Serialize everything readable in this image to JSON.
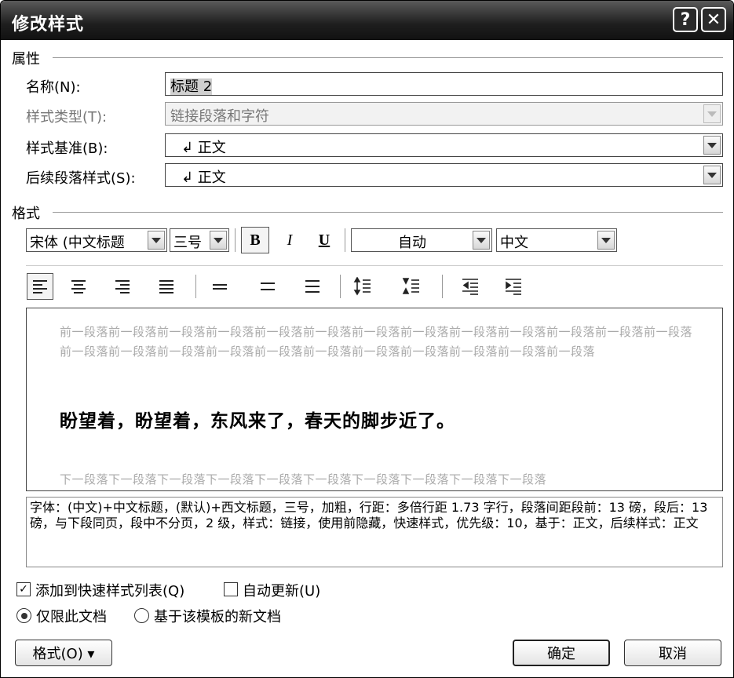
{
  "dialog": {
    "title": "修改样式",
    "help_label": "?",
    "close_label": "✕"
  },
  "properties": {
    "section_label": "属性",
    "name_label": "名称(N):",
    "name_value": "标题 2",
    "style_type_label": "样式类型(T):",
    "style_type_value": "链接段落和字符",
    "based_on_label": "样式基准(B):",
    "based_on_value": "↲ 正文",
    "following_label": "后续段落样式(S):",
    "following_value": "↲ 正文"
  },
  "format": {
    "section_label": "格式",
    "font_value": "宋体 (中文标题",
    "size_value": "三号",
    "bold_label": "B",
    "italic_label": "I",
    "underline_label": "U",
    "color_value": "自动",
    "language_value": "中文"
  },
  "preview": {
    "prev_paragraph": "前一段落前一段落前一段落前一段落前一段落前一段落前一段落前一段落前一段落前一段落前一段落前一段落前一段落前一段落前一段落前一段落前一段落前一段落前一段落前一段落前一段落前一段落前一段落前一段落",
    "sample_text": "盼望着，盼望着，东风来了，春天的脚步近了。",
    "next_paragraph": "下一段落下一段落下一段落下一段落下一段落下一段落下一段落下一段落下一段落下一段落"
  },
  "description": "字体：(中文)+中文标题，(默认)+西文标题，三号，加粗，行距：多倍行距 1.73 字行，段落间距段前：13 磅，段后：13 磅，与下段同页，段中不分页，2 级，样式：链接，使用前隐藏，快速样式，优先级：10，基于：正文，后续样式：正文",
  "options": {
    "add_quick_style": "添加到快速样式列表(Q)",
    "add_quick_style_checked": true,
    "auto_update": "自动更新(U)",
    "auto_update_checked": false,
    "this_document_only": "仅限此文档",
    "new_docs_template": "基于该模板的新文档",
    "selected_scope": "this_document_only"
  },
  "buttons": {
    "format_menu": "格式(O) ▾",
    "ok": "确定",
    "cancel": "取消"
  }
}
